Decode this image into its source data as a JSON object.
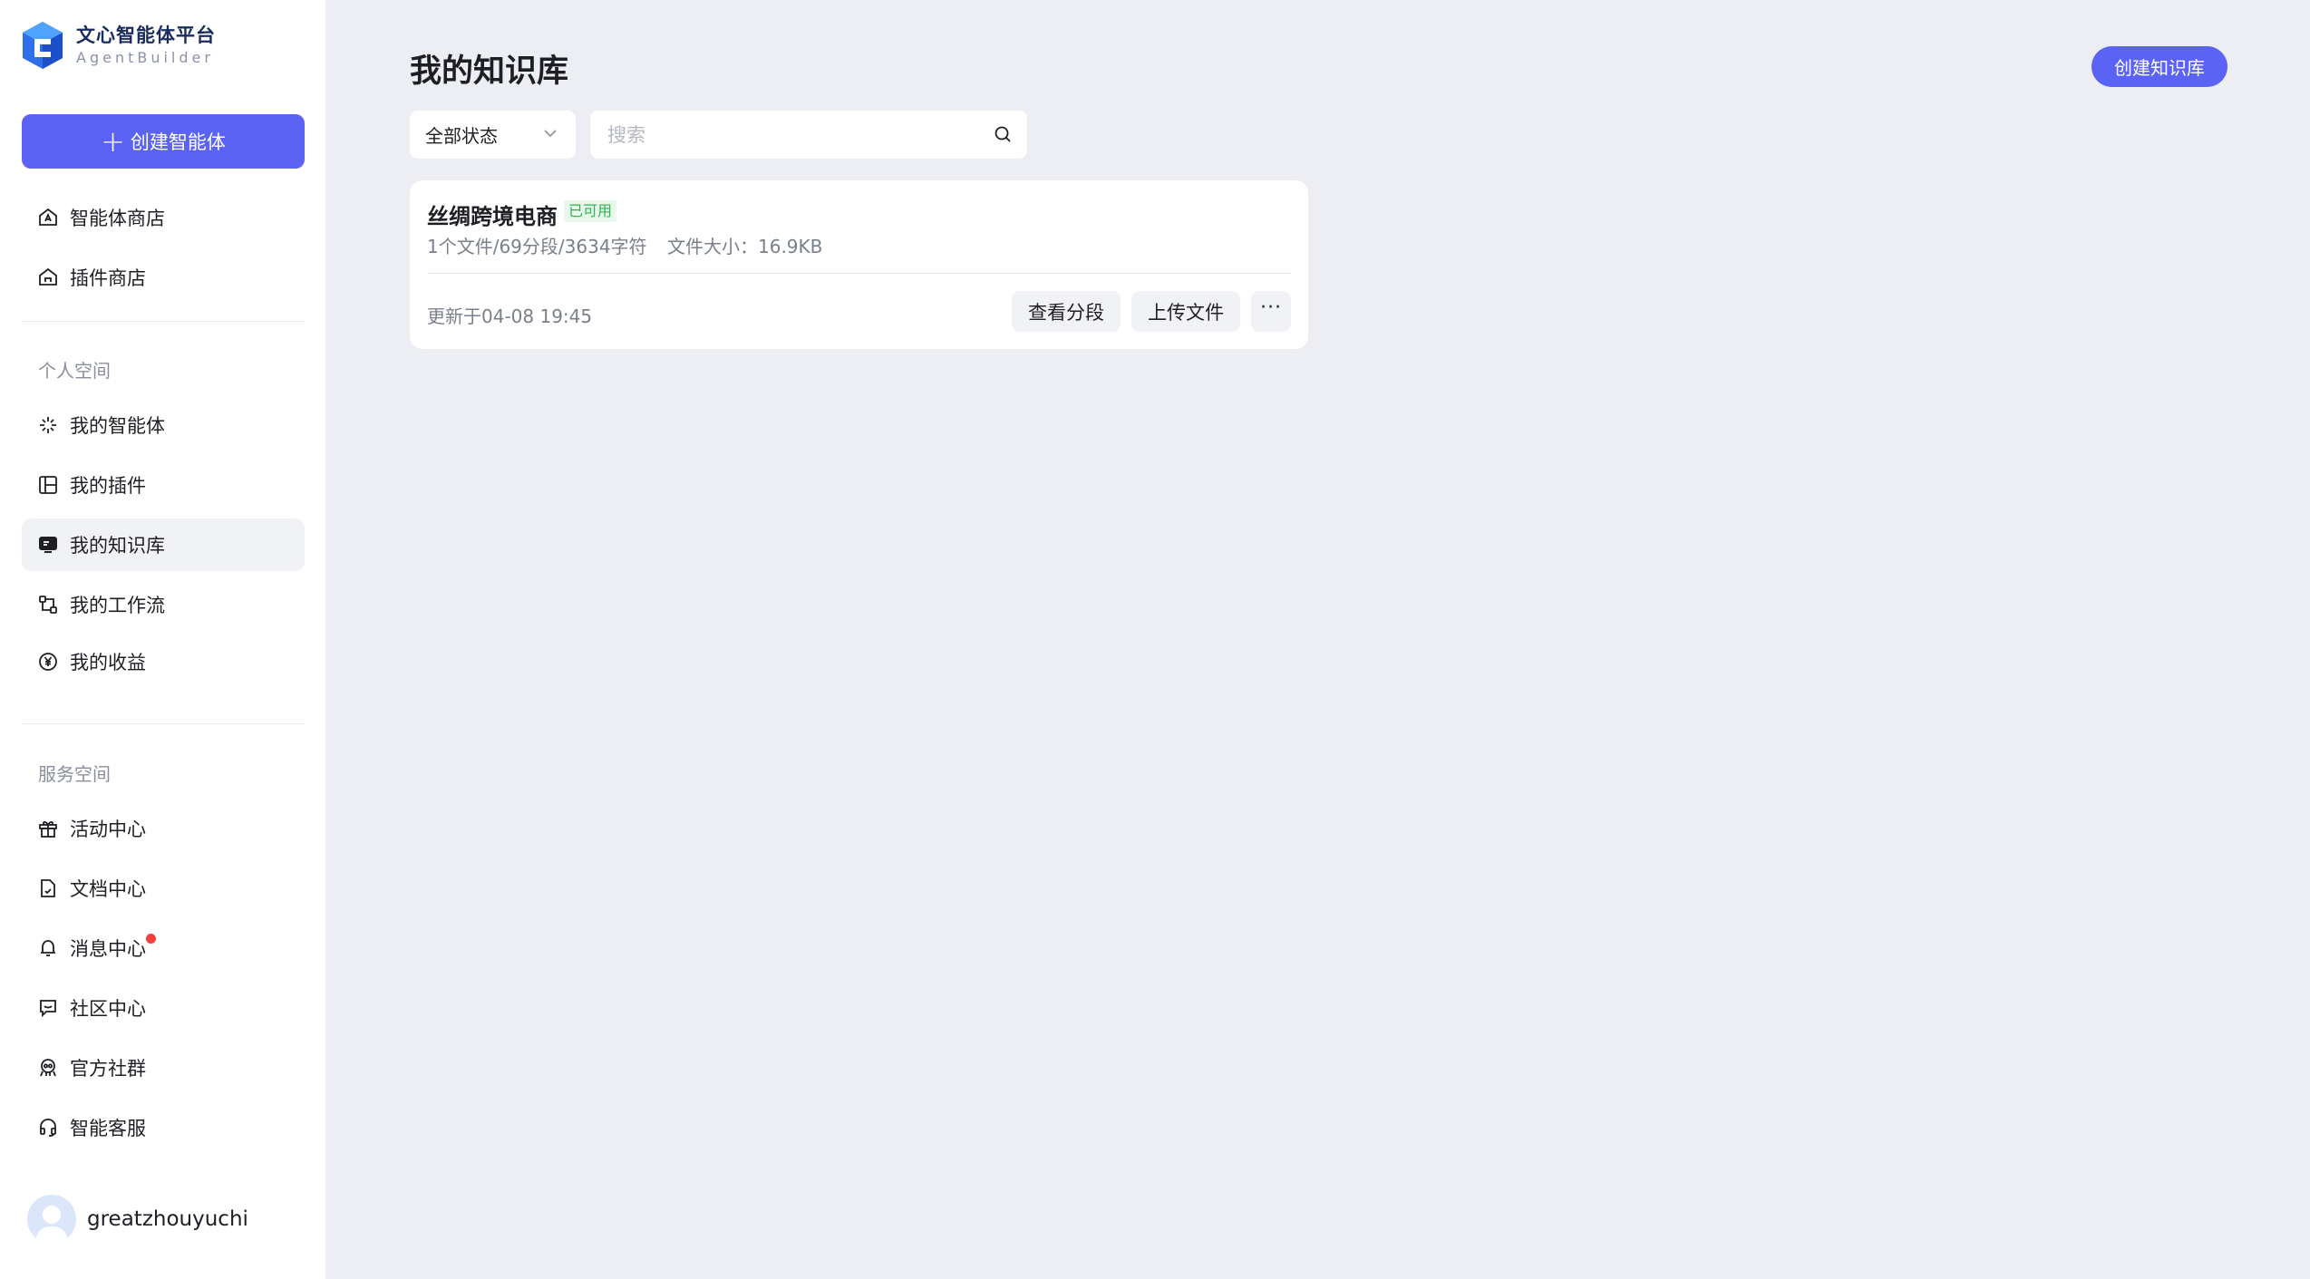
{
  "app": {
    "title": "文心智能体平台",
    "subtitle": "AgentBuilder",
    "brand_color": "#5b63f5"
  },
  "sidebar": {
    "create_button": "创建智能体",
    "top_items": [
      {
        "label": "智能体商店",
        "icon": "store-icon"
      },
      {
        "label": "插件商店",
        "icon": "plugin-store-icon"
      }
    ],
    "personal_section": "个人空间",
    "personal_items": [
      {
        "label": "我的智能体",
        "icon": "sparkle-icon"
      },
      {
        "label": "我的插件",
        "icon": "plugin-icon"
      },
      {
        "label": "我的知识库",
        "icon": "knowledge-icon",
        "active": true
      },
      {
        "label": "我的工作流",
        "icon": "workflow-icon"
      },
      {
        "label": "我的收益",
        "icon": "yen-icon"
      }
    ],
    "service_section": "服务空间",
    "service_items": [
      {
        "label": "活动中心",
        "icon": "gift-icon"
      },
      {
        "label": "文档中心",
        "icon": "document-icon"
      },
      {
        "label": "消息中心",
        "icon": "bell-icon",
        "has_notification": true
      },
      {
        "label": "社区中心",
        "icon": "chat-icon"
      },
      {
        "label": "官方社群",
        "icon": "community-icon"
      },
      {
        "label": "智能客服",
        "icon": "headset-icon"
      }
    ],
    "user": {
      "name": "greatzhouyuchi"
    }
  },
  "main": {
    "title": "我的知识库",
    "create_button": "创建知识库",
    "status_filter": "全部状态",
    "search_placeholder": "搜索",
    "knowledge_bases": [
      {
        "name": "丝绸跨境电商",
        "status": "已可用",
        "stats": "1个文件/69分段/3634字符",
        "size": "文件大小：16.9KB",
        "updated": "更新于04-08 19:45",
        "actions": {
          "view": "查看分段",
          "upload": "上传文件",
          "more": "···"
        }
      }
    ]
  }
}
